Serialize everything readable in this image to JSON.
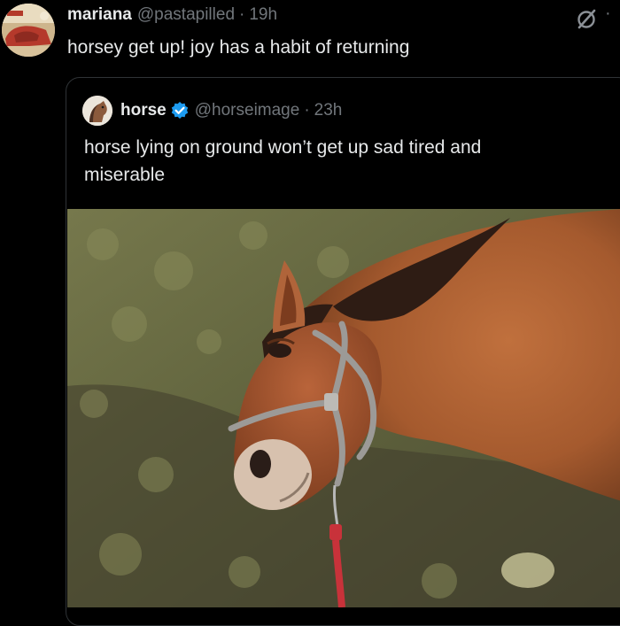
{
  "post": {
    "author": {
      "name": "mariana",
      "handle": "@pastapilled",
      "separator": "·",
      "time": "19h",
      "avatar_icon": "profile-avatar"
    },
    "text": "horsey get up! joy has a habit of returning",
    "actions": {
      "grok_icon": "grok-icon",
      "more_icon": "more-dots-icon",
      "more_label": "·"
    }
  },
  "quoted_post": {
    "author": {
      "name": "horse",
      "verified": true,
      "handle": "@horseimage",
      "separator": "·",
      "time": "23h",
      "avatar_icon": "horse-avatar"
    },
    "text": "horse lying on ground won’t get up sad tired and miserable",
    "media": {
      "type": "photo",
      "icon": "horse-lying-photo"
    }
  },
  "colors": {
    "background": "#000000",
    "primary_text": "#e7e9ea",
    "secondary_text": "#71767b",
    "border": "#2f3336",
    "verified_blue": "#1d9bf0"
  }
}
